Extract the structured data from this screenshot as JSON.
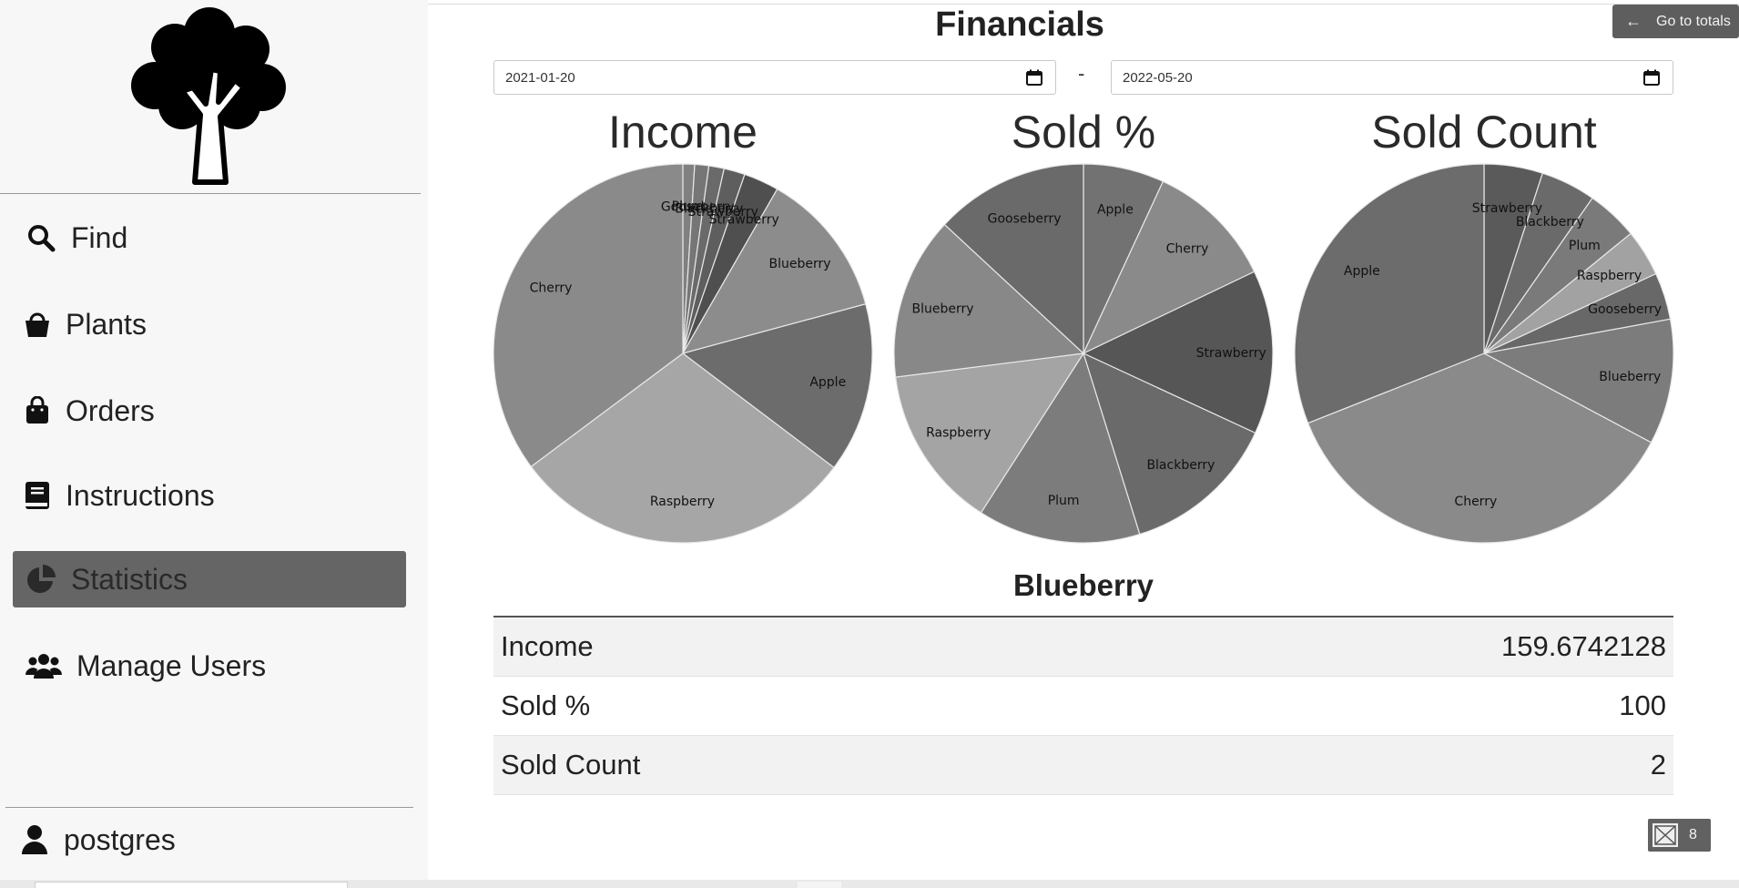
{
  "sidebar": {
    "items": [
      {
        "label": "Find",
        "icon": "search-icon"
      },
      {
        "label": "Plants",
        "icon": "basket-icon"
      },
      {
        "label": "Orders",
        "icon": "shopping-bag-icon"
      },
      {
        "label": "Instructions",
        "icon": "book-icon"
      },
      {
        "label": "Statistics",
        "icon": "pie-chart-icon",
        "active": true
      },
      {
        "label": "Manage Users",
        "icon": "users-icon"
      }
    ],
    "user": "postgres"
  },
  "header": {
    "title": "Financials",
    "go_totals_label": "Go to totals"
  },
  "filters": {
    "date_from": "2021-01-20",
    "separator": "-",
    "date_to": "2022-05-20"
  },
  "chart_data": [
    {
      "type": "pie",
      "title": "Income",
      "slices": [
        {
          "label": "Plum",
          "value": 1.0
        },
        {
          "label": "Gooseberry",
          "value": 1.2
        },
        {
          "label": "Blackberry",
          "value": 1.3
        },
        {
          "label": "Strawberry",
          "value": 1.8
        },
        {
          "label": "Strawberry",
          "value": 3.0
        },
        {
          "label": "Blueberry",
          "value": 12.5
        },
        {
          "label": "Apple",
          "value": 14.5
        },
        {
          "label": "Raspberry",
          "value": 29.5
        },
        {
          "label": "Cherry",
          "value": 35.2
        }
      ]
    },
    {
      "type": "pie",
      "title": "Sold %",
      "slices": [
        {
          "label": "Apple",
          "value": 6.9
        },
        {
          "label": "Cherry",
          "value": 11.0
        },
        {
          "label": "Strawberry",
          "value": 14.0
        },
        {
          "label": "Blackberry",
          "value": 13.3
        },
        {
          "label": "Plum",
          "value": 13.9
        },
        {
          "label": "Raspberry",
          "value": 13.9
        },
        {
          "label": "Blueberry",
          "value": 13.9
        },
        {
          "label": "Gooseberry",
          "value": 13.1
        }
      ]
    },
    {
      "type": "pie",
      "title": "Sold Count",
      "slices": [
        {
          "label": "Strawberry",
          "value": 5.0
        },
        {
          "label": "Blackberry",
          "value": 4.7
        },
        {
          "label": "Plum",
          "value": 4.4
        },
        {
          "label": "Raspberry",
          "value": 4.0
        },
        {
          "label": "Gooseberry",
          "value": 4.0
        },
        {
          "label": "Blueberry",
          "value": 10.7
        },
        {
          "label": "Cherry",
          "value": 36.2
        },
        {
          "label": "Apple",
          "value": 31.0
        }
      ]
    }
  ],
  "detail": {
    "title": "Blueberry",
    "rows": [
      {
        "label": "Income",
        "value": "159.6742128"
      },
      {
        "label": "Sold %",
        "value": "100"
      },
      {
        "label": "Sold Count",
        "value": "2"
      }
    ]
  },
  "badge": {
    "count": "8"
  },
  "colors": {
    "active_nav": "#656565",
    "button": "#5e5e5e",
    "pie_shades": [
      "#8a8a8a",
      "#767676",
      "#6e6e6e",
      "#5e5e5e",
      "#525252",
      "#8c8c8c",
      "#6c6c6c",
      "#a6a6a6",
      "#8a8a8a"
    ]
  }
}
